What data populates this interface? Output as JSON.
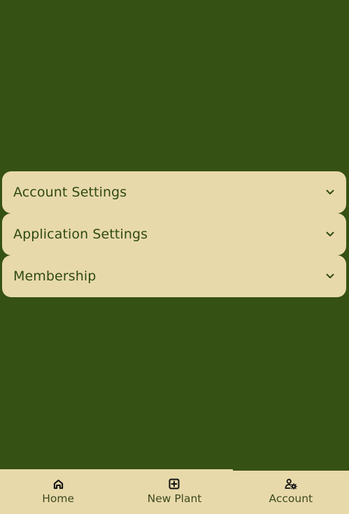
{
  "accordion": {
    "items": [
      {
        "label": "Account Settings",
        "icon": "chevron-down-icon"
      },
      {
        "label": "Application Settings",
        "icon": "chevron-down-icon"
      },
      {
        "label": "Membership",
        "icon": "chevron-down-icon"
      }
    ]
  },
  "bottom_nav": {
    "items": [
      {
        "label": "Home",
        "icon": "home-icon",
        "active": false
      },
      {
        "label": "New Plant",
        "icon": "plus-square-icon",
        "active": false
      },
      {
        "label": "Account",
        "icon": "user-gear-icon",
        "active": true
      }
    ]
  },
  "colors": {
    "background": "#365114",
    "panel": "#e8d9ab",
    "text": "#2f4a12"
  }
}
